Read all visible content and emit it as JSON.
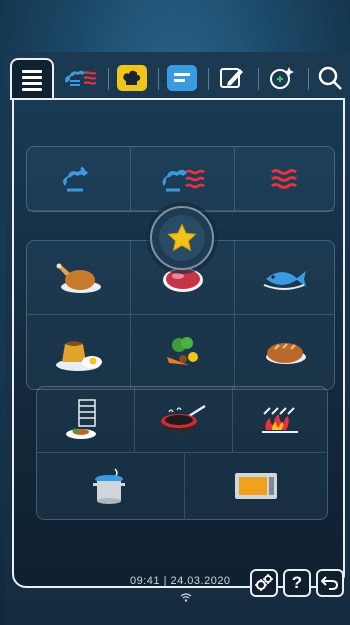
{
  "tabs": [
    {
      "name": "menu",
      "icon": "hamburger-menu-icon",
      "active": true
    },
    {
      "name": "humidity-heat",
      "icon": "steam-heat-icon"
    },
    {
      "name": "cookbook",
      "icon": "chef-hat-icon",
      "color": "#f0c419"
    },
    {
      "name": "programs",
      "icon": "list-icon",
      "color": "#3a9be0"
    },
    {
      "name": "edit",
      "icon": "pencil-note-icon"
    },
    {
      "name": "assistant",
      "icon": "sparkle-icon"
    },
    {
      "name": "search",
      "icon": "search-icon"
    }
  ],
  "modes": [
    {
      "name": "steam",
      "icon": "steam-cloud-icon"
    },
    {
      "name": "combi",
      "icon": "combi-steam-heat-icon"
    },
    {
      "name": "dry-heat",
      "icon": "dry-heat-waves-icon"
    }
  ],
  "favorites": {
    "icon": "star-icon"
  },
  "categories": [
    {
      "name": "poultry",
      "icon": "roast-chicken-icon"
    },
    {
      "name": "meat",
      "icon": "meat-cut-icon"
    },
    {
      "name": "fish",
      "icon": "fish-icon"
    },
    {
      "name": "egg-dishes-desserts",
      "icon": "pudding-egg-icon"
    },
    {
      "name": "side-dishes",
      "icon": "vegetables-icon"
    },
    {
      "name": "bakery",
      "icon": "bread-loaf-icon"
    }
  ],
  "methods": [
    {
      "name": "finishing",
      "icon": "plate-rack-icon"
    },
    {
      "name": "pan-frying",
      "icon": "frying-pan-icon"
    },
    {
      "name": "grilling",
      "icon": "grill-icon"
    },
    {
      "name": "boiling",
      "icon": "steaming-pot-icon"
    },
    {
      "name": "holding",
      "icon": "holding-cabinet-icon"
    }
  ],
  "footer": {
    "status_text": "09:41 | 24.03.2020",
    "wifi_icon": "wifi-icon",
    "settings_icon": "settings-gears-icon",
    "help_label": "?",
    "back_icon": "back-arrow-icon"
  },
  "colors": {
    "accent_blue": "#3a9be0",
    "accent_red": "#e8323c",
    "accent_yellow": "#f0c419",
    "border": "#e9eef2"
  }
}
